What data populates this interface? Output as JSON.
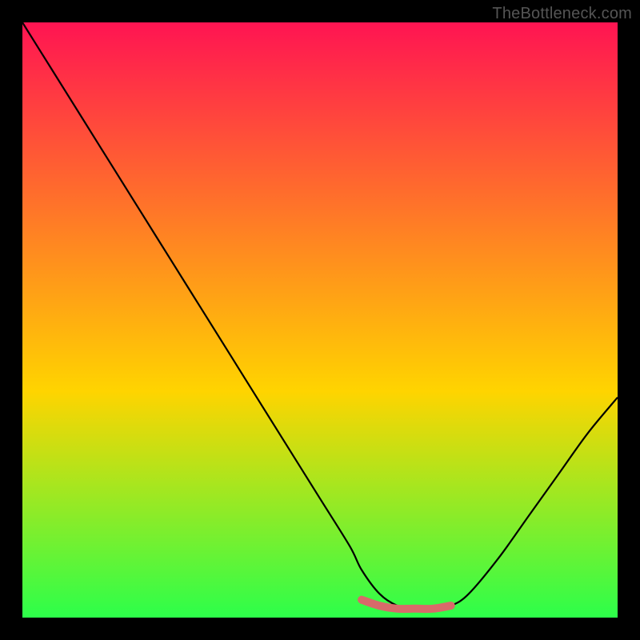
{
  "watermark": "TheBottleneck.com",
  "chart_data": {
    "type": "line",
    "title": "",
    "xlabel": "",
    "ylabel": "",
    "xlim": [
      0,
      100
    ],
    "ylim": [
      0,
      100
    ],
    "grid": false,
    "legend": false,
    "annotations": [],
    "background_gradient": {
      "top_color": "#ff1452",
      "mid_color": "#ffd400",
      "bottom_color": "#2cff4a"
    },
    "series": [
      {
        "name": "curve",
        "color": "#000000",
        "x": [
          0,
          5,
          10,
          15,
          20,
          25,
          30,
          35,
          40,
          45,
          50,
          55,
          57,
          60,
          63,
          66,
          69,
          72,
          75,
          80,
          85,
          90,
          95,
          100
        ],
        "values": [
          100,
          92,
          84,
          76,
          68,
          60,
          52,
          44,
          36,
          28,
          20,
          12,
          8,
          4,
          2,
          1.5,
          1.5,
          2,
          4,
          10,
          17,
          24,
          31,
          37
        ]
      },
      {
        "name": "highlight-band",
        "color": "#d86a6a",
        "x": [
          57,
          60,
          63,
          66,
          69,
          72
        ],
        "values": [
          3,
          2,
          1.5,
          1.5,
          1.5,
          2
        ]
      }
    ]
  }
}
